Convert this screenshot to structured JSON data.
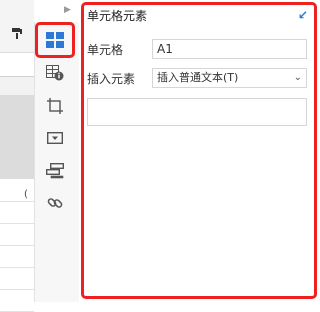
{
  "spreadsheet": {
    "column_header_label": "13",
    "partial_cell_text": "("
  },
  "rail": {
    "items": [
      {
        "name": "cell-element",
        "icon": "cell-grid-icon"
      },
      {
        "name": "cell-attribute",
        "icon": "grid-info-icon"
      },
      {
        "name": "border",
        "icon": "crop-frame-icon"
      },
      {
        "name": "widget",
        "icon": "dropdown-box-icon"
      },
      {
        "name": "expand",
        "icon": "stack-icon"
      },
      {
        "name": "hyperlink",
        "icon": "link-icon"
      }
    ]
  },
  "panel": {
    "title": "单元格元素",
    "cell_label": "单元格",
    "cell_value": "A1",
    "insert_label": "插入元素",
    "insert_selected": "插入普通文本(T)",
    "text_value": ""
  },
  "colors": {
    "highlight_red": "#ee2020",
    "active_blue": "#2b78d6"
  }
}
